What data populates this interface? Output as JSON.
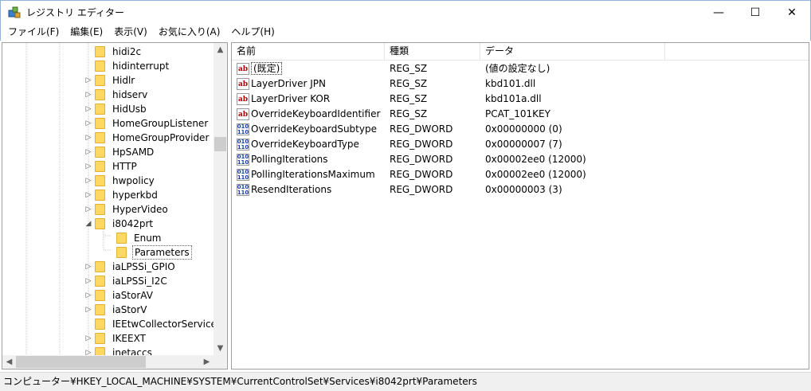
{
  "window": {
    "title": "レジストリ エディター",
    "minimize": "—",
    "maximize": "☐",
    "close": "✕"
  },
  "menu": [
    "ファイル(F)",
    "編集(E)",
    "表示(V)",
    "お気に入り(A)",
    "ヘルプ(H)"
  ],
  "tree": {
    "items": [
      {
        "label": "hidi2c",
        "toggle": ""
      },
      {
        "label": "hidinterrupt",
        "toggle": ""
      },
      {
        "label": "Hidlr",
        "toggle": "▷"
      },
      {
        "label": "hidserv",
        "toggle": "▷"
      },
      {
        "label": "HidUsb",
        "toggle": "▷"
      },
      {
        "label": "HomeGroupListener",
        "toggle": "▷"
      },
      {
        "label": "HomeGroupProvider",
        "toggle": "▷"
      },
      {
        "label": "HpSAMD",
        "toggle": "▷"
      },
      {
        "label": "HTTP",
        "toggle": "▷"
      },
      {
        "label": "hwpolicy",
        "toggle": "▷"
      },
      {
        "label": "hyperkbd",
        "toggle": "▷"
      },
      {
        "label": "HyperVideo",
        "toggle": "▷"
      },
      {
        "label": "i8042prt",
        "toggle": "◢"
      },
      {
        "label": "Enum",
        "toggle": "",
        "child": true
      },
      {
        "label": "Parameters",
        "toggle": "",
        "child": true,
        "selected": true
      },
      {
        "label": "iaLPSSi_GPIO",
        "toggle": "▷"
      },
      {
        "label": "iaLPSSi_I2C",
        "toggle": "▷"
      },
      {
        "label": "iaStorAV",
        "toggle": "▷"
      },
      {
        "label": "iaStorV",
        "toggle": "▷"
      },
      {
        "label": "IEEtwCollectorService",
        "toggle": ""
      },
      {
        "label": "IKEEXT",
        "toggle": "▷"
      },
      {
        "label": "inetaccs",
        "toggle": "▷"
      }
    ]
  },
  "values": {
    "headers": [
      "名前",
      "種類",
      "データ"
    ],
    "rows": [
      {
        "icon": "sz",
        "name": "(既定)",
        "type": "REG_SZ",
        "data": "(値の設定なし)",
        "default": true
      },
      {
        "icon": "sz",
        "name": "LayerDriver JPN",
        "type": "REG_SZ",
        "data": "kbd101.dll"
      },
      {
        "icon": "sz",
        "name": "LayerDriver KOR",
        "type": "REG_SZ",
        "data": "kbd101a.dll"
      },
      {
        "icon": "sz",
        "name": "OverrideKeyboardIdentifier",
        "type": "REG_SZ",
        "data": "PCAT_101KEY"
      },
      {
        "icon": "dw",
        "name": "OverrideKeyboardSubtype",
        "type": "REG_DWORD",
        "data": "0x00000000 (0)"
      },
      {
        "icon": "dw",
        "name": "OverrideKeyboardType",
        "type": "REG_DWORD",
        "data": "0x00000007 (7)"
      },
      {
        "icon": "dw",
        "name": "PollingIterations",
        "type": "REG_DWORD",
        "data": "0x00002ee0 (12000)"
      },
      {
        "icon": "dw",
        "name": "PollingIterationsMaximum",
        "type": "REG_DWORD",
        "data": "0x00002ee0 (12000)"
      },
      {
        "icon": "dw",
        "name": "ResendIterations",
        "type": "REG_DWORD",
        "data": "0x00000003 (3)"
      }
    ]
  },
  "icons": {
    "sz": "ab",
    "dw": "010\n110"
  },
  "status": "コンピューター¥HKEY_LOCAL_MACHINE¥SYSTEM¥CurrentControlSet¥Services¥i8042prt¥Parameters"
}
